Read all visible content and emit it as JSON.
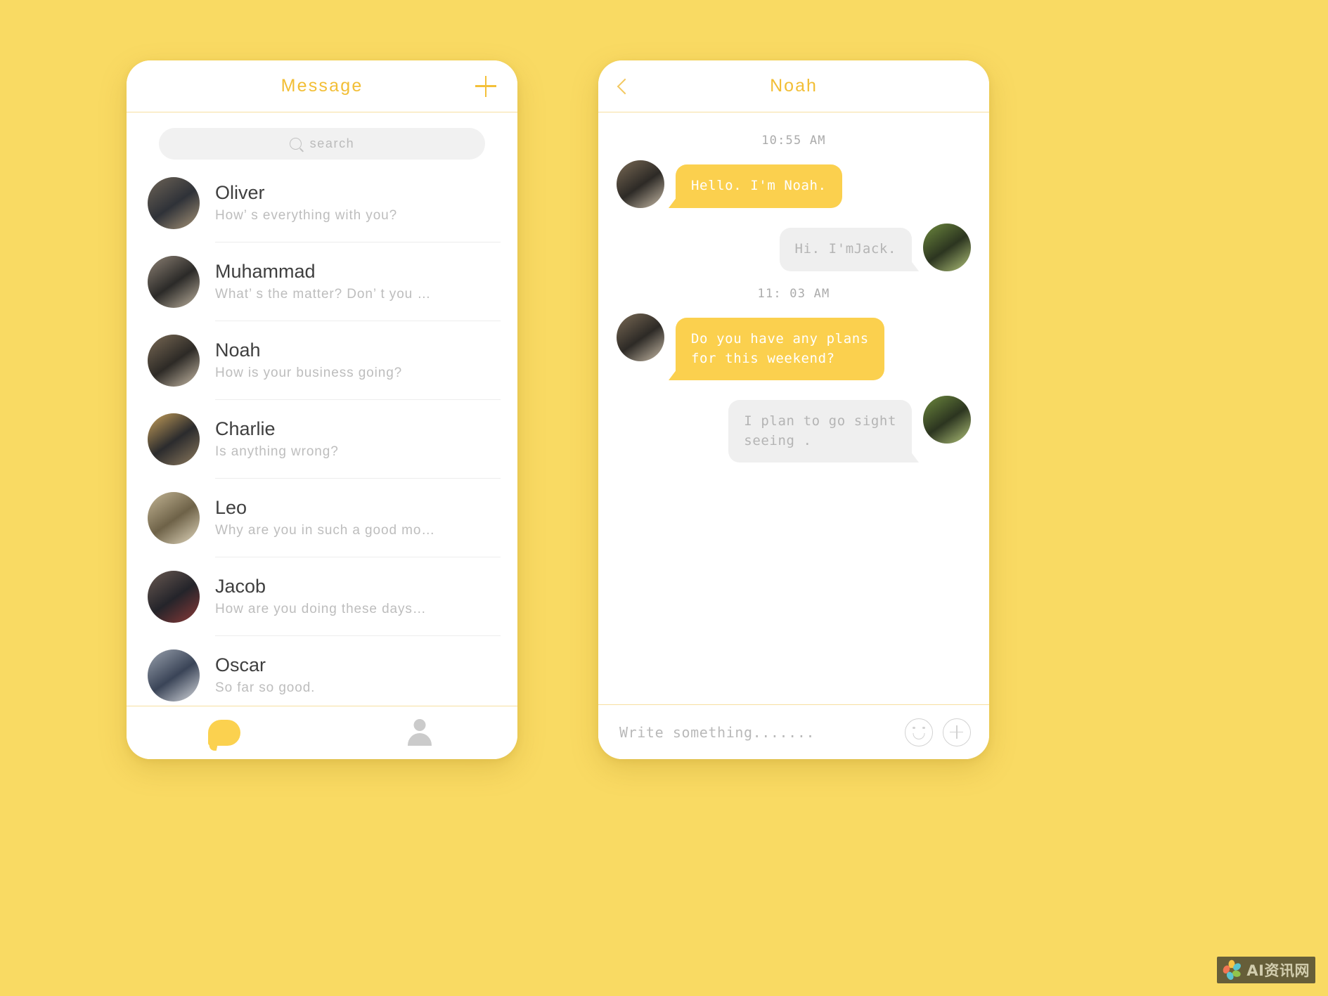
{
  "theme": {
    "background": "#F9DA63",
    "accent": "#F2BE35",
    "bubble_yellow": "#FBD04E",
    "bubble_gray": "#EFEFEF",
    "divider": "#F7DFA0"
  },
  "message_list_screen": {
    "header": {
      "title": "Message",
      "add_icon": "plus-icon"
    },
    "search": {
      "placeholder": "search",
      "icon": "search-icon",
      "value": ""
    },
    "contacts": [
      {
        "name": "Oliver",
        "preview": "How’  s everything with you?",
        "avatar": "avatar-oliver"
      },
      {
        "name": "Muhammad",
        "preview": "What’  s the matter? Don’  t you …",
        "avatar": "avatar-muhammad"
      },
      {
        "name": "Noah",
        "preview": "How is your business going?",
        "avatar": "avatar-noah"
      },
      {
        "name": "Charlie",
        "preview": "Is anything wrong?",
        "avatar": "avatar-charlie"
      },
      {
        "name": "Leo",
        "preview": "Why are you in such a good mo…",
        "avatar": "avatar-leo"
      },
      {
        "name": "Jacob",
        "preview": "How are you doing these days…",
        "avatar": "avatar-jacob"
      },
      {
        "name": "Oscar",
        "preview": "So far so good.",
        "avatar": "avatar-oscar"
      }
    ],
    "tabs": [
      {
        "name": "chats",
        "icon": "chat-bubble-icon",
        "active": true
      },
      {
        "name": "contacts",
        "icon": "person-icon",
        "active": false
      }
    ]
  },
  "chat_screen": {
    "header": {
      "title": "Noah",
      "back_icon": "chevron-left-icon"
    },
    "thread": [
      {
        "kind": "timestamp",
        "text": "10:55 AM"
      },
      {
        "kind": "message",
        "side": "in",
        "text": "Hello. I'm Noah.",
        "avatar": "avatar-noah"
      },
      {
        "kind": "message",
        "side": "out",
        "text": "Hi. I'mJack.",
        "avatar": "avatar-jack"
      },
      {
        "kind": "timestamp",
        "text": "11: 03 AM"
      },
      {
        "kind": "message",
        "side": "in",
        "text": "Do you have any plans\nfor this weekend?",
        "avatar": "avatar-noah"
      },
      {
        "kind": "message",
        "side": "out",
        "text": "I plan to go sight\nseeing .",
        "avatar": "avatar-jack"
      }
    ],
    "input": {
      "placeholder": "Write something.......",
      "value": "",
      "emoji_icon": "smiley-icon",
      "add_icon": "plus-circle-icon"
    }
  },
  "watermark": {
    "text": "AI资讯网",
    "logo": "flower-logo-icon"
  }
}
